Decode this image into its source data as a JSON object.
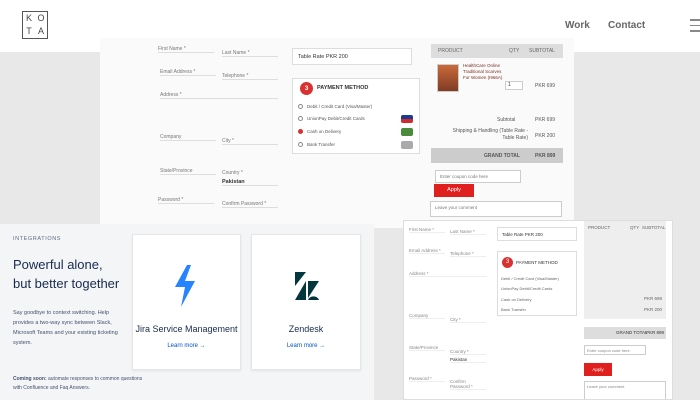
{
  "header": {
    "logo_letters": [
      "K",
      "O",
      "T",
      "A"
    ],
    "nav": [
      "Work",
      "Contact"
    ]
  },
  "checkout": {
    "fields": {
      "first_name": "First Name *",
      "last_name": "Last Name *",
      "email": "Email Address *",
      "telephone": "Telephone *",
      "address": "Address *",
      "company": "Company",
      "city": "City *",
      "state": "State/Province",
      "country": "Country *",
      "country_value": "Pakistan",
      "password": "Password *",
      "confirm_password": "Confirm Password *"
    },
    "table_rate": "Table Rate PKR 200",
    "payment": {
      "step": "3",
      "title": "PAYMENT METHOD",
      "options": [
        "Debit / Credit Card (Visa/Master)",
        "UnionPay Debit/Credit Cards",
        "Cash on Delivery",
        "Bank Transfer"
      ]
    },
    "order": {
      "headers": [
        "PRODUCT",
        "QTY",
        "SUBTOTAL"
      ],
      "product_name": "HealthCare Online Traditional Scarves For Women (I966A)",
      "qty": "1",
      "product_subtotal": "PKR 699",
      "subtotal_label": "Subtotal",
      "subtotal_value": "PKR 699",
      "shipping_label": "Shipping & Handling (Table Rate - Table Rate)",
      "shipping_value": "PKR 200",
      "grand_label": "GRAND TOTAL",
      "grand_value": "PKR 899"
    },
    "coupon_placeholder": "Enter coupon code here",
    "apply_label": "Apply",
    "comment_placeholder": "Leave your comment"
  },
  "integrations": {
    "eyebrow": "INTEGRATIONS",
    "headline": "Powerful alone, but better together",
    "subtext": "Say goodbye to context switching. Help provides a two-way sync between Slack, Microsoft Teams and your existing ticketing system.",
    "cards": [
      {
        "name": "Jira Service Management",
        "link": "Learn more →"
      },
      {
        "name": "Zendesk",
        "link": "Learn more →"
      }
    ],
    "footnote_bold": "Coming soon:",
    "footnote": " automate responses to common questions with Confluence and Faq Answers."
  },
  "mini": {
    "fields": [
      "First Name *",
      "Last Name *",
      "Email Address *",
      "Telephone *",
      "Address *",
      "Company",
      "City *",
      "State/Province",
      "Country *",
      "Pakistan",
      "Password *",
      "Confirm Password *"
    ],
    "table_rate": "Table Rate PKR 200",
    "payment_title": "PAYMENT METHOD",
    "payment_options": [
      "Debit / Credit Card (Visa/Master)",
      "UnionPay Debit/Credit Cards",
      "Cash on Delivery",
      "Bank Transfer"
    ],
    "order_headers": [
      "PRODUCT",
      "QTY",
      "SUBTOTAL"
    ],
    "subtotal": "PKR 699",
    "shipping": "PKR 200",
    "grand_label": "GRAND TOTAL",
    "grand": "PKR 899",
    "coupon": "Enter coupon code here",
    "apply": "Apply",
    "comment": "Leave your comment"
  },
  "colors": {
    "accent_red": "#e0201e",
    "jira_blue": "#2684ff",
    "zendesk_dark": "#03363d",
    "link_blue": "#0052cc"
  },
  "icons": [
    "hamburger-menu-icon",
    "jira-logo-icon",
    "zendesk-logo-icon",
    "visa-card-icon",
    "cash-icon",
    "bank-icon"
  ]
}
